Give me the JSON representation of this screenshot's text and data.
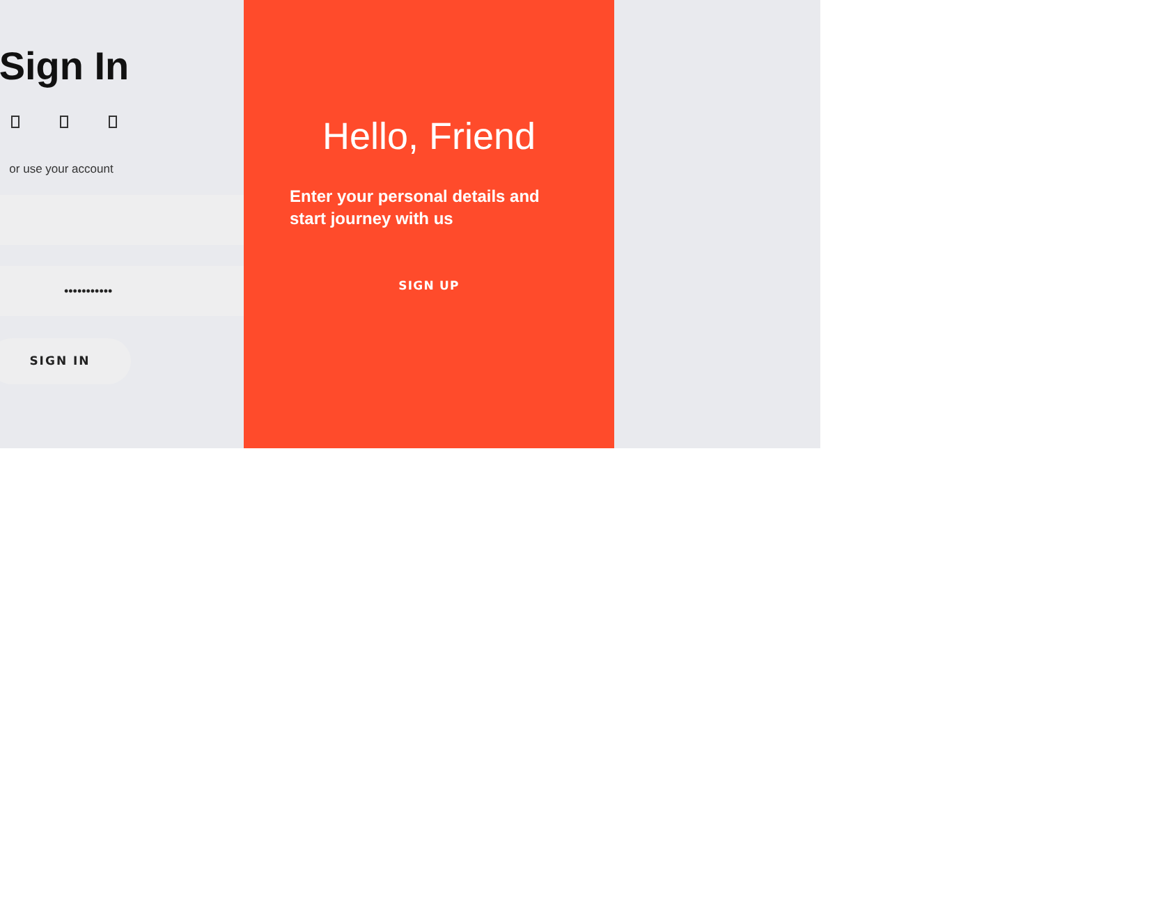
{
  "sign_in": {
    "title": "Sign In",
    "social_icons": [
      {
        "kind": "missing-glyph"
      },
      {
        "kind": "missing-glyph"
      },
      {
        "kind": "missing-glyph"
      }
    ],
    "hint": "or use your account",
    "password": {
      "value": "•••••••••••"
    },
    "button": "SIGN IN"
  },
  "overlay": {
    "title": "Hello, Friend",
    "text": "Enter your personal details and start journey with us",
    "button": "SIGN UP"
  }
}
